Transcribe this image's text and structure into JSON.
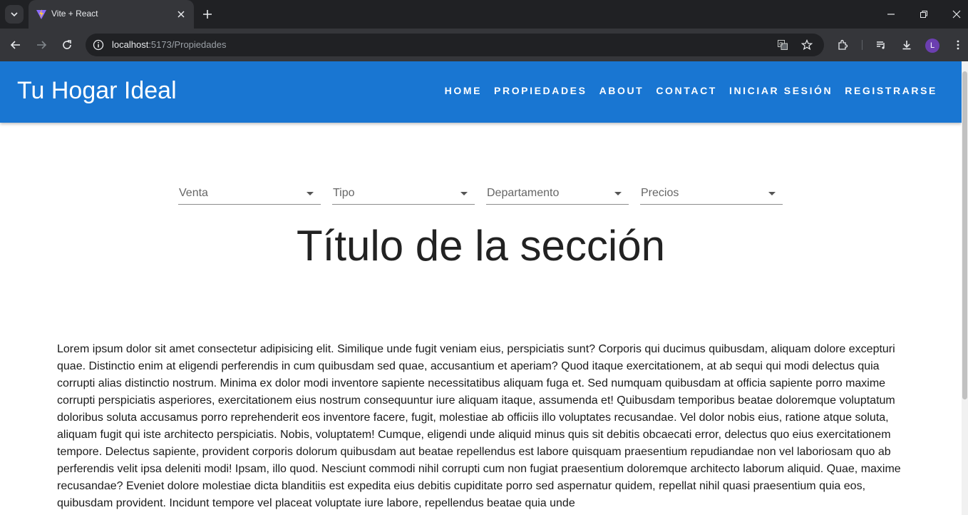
{
  "browser": {
    "tab_title": "Vite + React",
    "url_host": "localhost",
    "url_path": ":5173/Propiedades",
    "avatar_initial": "L",
    "icons": [
      "tab-search-icon",
      "vite-favicon-icon",
      "close-icon",
      "new-tab-icon",
      "minimize-icon",
      "restore-icon",
      "window-close-icon",
      "back-icon",
      "forward-icon",
      "reload-icon",
      "info-icon",
      "translate-icon",
      "star-icon",
      "extensions-icon",
      "media-icon",
      "download-icon",
      "menu-icon"
    ]
  },
  "header": {
    "brand": "Tu Hogar Ideal",
    "nav": [
      "HOME",
      "PROPIEDADES",
      "ABOUT",
      "CONTACT",
      "INICIAR SESIÓN",
      "REGISTRARSE"
    ],
    "color": "#1976d2"
  },
  "filters": [
    "Venta",
    "Tipo",
    "Departamento",
    "Precios"
  ],
  "main": {
    "title": "Título de la sección",
    "paragraph": "Lorem ipsum dolor sit amet consectetur adipisicing elit. Similique unde fugit veniam eius, perspiciatis sunt? Corporis qui ducimus quibusdam, aliquam dolore excepturi quae. Distinctio enim at eligendi perferendis in cum quibusdam sed quae, accusantium et aperiam? Quod itaque exercitationem, at ab sequi qui modi delectus quia corrupti alias distinctio nostrum. Minima ex dolor modi inventore sapiente necessitatibus aliquam fuga et. Sed numquam quibusdam at officia sapiente porro maxime corrupti perspiciatis asperiores, exercitationem eius nostrum consequuntur iure aliquam itaque, assumenda et! Quibusdam temporibus beatae doloremque voluptatum doloribus soluta accusamus porro reprehenderit eos inventore facere, fugit, molestiae ab officiis illo voluptates recusandae. Vel dolor nobis eius, ratione atque soluta, aliquam fugit qui iste architecto perspiciatis. Nobis, voluptatem! Cumque, eligendi unde aliquid minus quis sit debitis obcaecati error, delectus quo eius exercitationem tempore. Delectus sapiente, provident corporis dolorum quibusdam aut beatae repellendus est labore quisquam praesentium repudiandae non vel laboriosam quo ab perferendis velit ipsa deleniti modi! Ipsam, illo quod. Nesciunt commodi nihil corrupti cum non fugiat praesentium doloremque architecto laborum aliquid. Quae, maxime recusandae? Eveniet dolore molestiae dicta blanditiis est expedita eius debitis cupiditate porro sed aspernatur quidem, repellat nihil quasi praesentium quia eos, quibusdam provident. Incidunt tempore vel placeat voluptate iure labore, repellendus beatae quia unde"
  }
}
